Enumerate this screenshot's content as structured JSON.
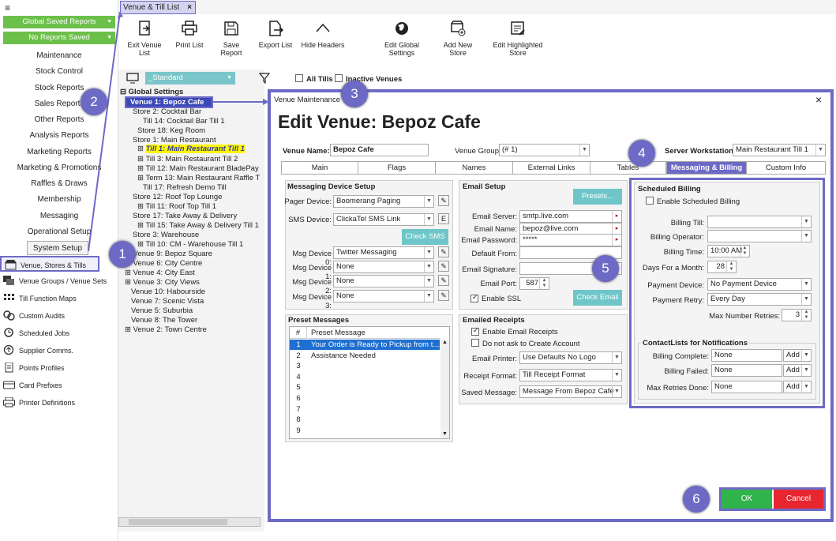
{
  "sidebar": {
    "menu_icon": "hamburger-icon",
    "global_saved_reports": "Global Saved Reports",
    "no_reports_saved": "No Reports Saved",
    "menu_items": [
      "Maintenance",
      "Stock Control",
      "Stock Reports",
      "Sales Reports",
      "Other Reports",
      "Analysis Reports",
      "Marketing Reports",
      "Marketing & Promotions",
      "Raffles & Draws",
      "Membership",
      "Messaging",
      "Operational Setup",
      "System Setup"
    ],
    "nav_items": [
      "Venue, Stores & Tills",
      "Venue Groups / Venue Sets",
      "Till Function Maps",
      "Custom Audits",
      "Scheduled Jobs",
      "Supplier Comms.",
      "Points Profiles",
      "Card Prefixes",
      "Printer Definitions"
    ]
  },
  "tab": {
    "label": "Venue & Till List",
    "close": "×"
  },
  "toolbar": {
    "buttons": [
      "Exit Venue List",
      "Print List",
      "Save Report",
      "Export List",
      "Hide Headers",
      "Edit Global Settings",
      "Add New Store",
      "Edit Highlighted Store"
    ]
  },
  "filters": {
    "dropdown": "_Standard",
    "all_tills": "All Tills",
    "inactive_venues": "Inactive Venues"
  },
  "tree": {
    "header": "Global Settings",
    "selected": "Venue 1: Bepoz Cafe",
    "nodes": [
      "Store 2: Cocktail Bar",
      "Till 14: Cocktail Bar Till 1",
      "Store 18: Keg Room",
      "Store 1: Main Restaurant",
      "Till 1: Main Restaurant Till 1",
      "Till 3: Main Restaurant Till 2",
      "Till 12: Main Restaurant BladePay",
      "Term 13: Main Restaurant Raffle T",
      "Till 17: Refresh Demo Till",
      "Store 12: Roof Top Lounge",
      "Till 11: Roof Top Till 1",
      "Store 17: Take Away & Delivery",
      "Till 15: Take Away & Delivery Till 1",
      "Store 3: Warehouse",
      "Till 10: CM - Warehouse Till 1",
      "Venue 9: Bepoz Square",
      "Venue 6: City Centre",
      "Venue 4: City East",
      "Venue 3: City Views",
      "Venue 10: Habourside",
      "Venue 7: Scenic Vista",
      "Venue 5: Suburbia",
      "Venue 8: The Tower",
      "Venue 2: Town Centre"
    ]
  },
  "dialog": {
    "window_title": "Venue Maintenance",
    "close": "×",
    "heading": "Edit Venue: Bepoz Cafe",
    "venue_name_label": "Venue Name:",
    "venue_name": "Bepoz Cafe",
    "venue_group_label": "Venue Group:",
    "venue_group": "(# 1)",
    "server_ws_label": "Server Workstation:",
    "server_ws": "Main Restaurant Till 1",
    "tabs": [
      "Main",
      "Flags",
      "Names",
      "External Links",
      "Tables",
      "Messaging & Billing",
      "Custom Info"
    ],
    "messaging": {
      "title": "Messaging Device Setup",
      "pager_label": "Pager Device:",
      "pager": "Boomerang Paging",
      "sms_label": "SMS Device:",
      "sms": "ClickaTel SMS Link",
      "sms_e": "E",
      "check_sms": "Check SMS",
      "msg_labels": [
        "Msg Device 0:",
        "Msg Device 1:",
        "Msg Device 2:",
        "Msg Device 3:"
      ],
      "msg_values": [
        "Twitter Messaging",
        "None",
        "None",
        "None"
      ]
    },
    "email": {
      "title": "Email Setup",
      "presets": "Presets...",
      "server_label": "Email Server:",
      "server": "smtp.live.com",
      "name_label": "Email Name:",
      "name": "bepoz@live.com",
      "password_label": "Email Password:",
      "password": "*****",
      "default_from_label": "Default From:",
      "signature_label": "Email Signature:",
      "port_label": "Email Port:",
      "port": "587",
      "ssl": "Enable SSL",
      "check_email": "Check Email"
    },
    "preset_messages": {
      "title": "Preset Messages",
      "col_num": "#",
      "col_msg": "Preset Message",
      "rows": [
        {
          "n": "1",
          "m": "Your Order is Ready to Pickup from t..."
        },
        {
          "n": "2",
          "m": "Assistance Needed"
        },
        {
          "n": "3",
          "m": ""
        },
        {
          "n": "4",
          "m": ""
        },
        {
          "n": "5",
          "m": ""
        },
        {
          "n": "6",
          "m": ""
        },
        {
          "n": "7",
          "m": ""
        },
        {
          "n": "8",
          "m": ""
        },
        {
          "n": "9",
          "m": ""
        }
      ]
    },
    "receipts": {
      "title": "Emailed Receipts",
      "enable": "Enable Email Receipts",
      "no_ask": "Do not ask to Create Account",
      "printer_label": "Email Printer:",
      "printer": "Use Defaults No Logo",
      "format_label": "Receipt Format:",
      "format": "Till Receipt Format",
      "saved_label": "Saved Message:",
      "saved": "Message From Bepoz Cafe"
    },
    "billing": {
      "title": "Scheduled Billing",
      "enable": "Enable Scheduled Billing",
      "till_label": "Billing Till:",
      "operator_label": "Billing Operator:",
      "time_label": "Billing Time:",
      "time": "10:00 AM",
      "days_label": "Days For a Month:",
      "days": "28",
      "payment_device_label": "Payment Device:",
      "payment_device": "No Payment Device",
      "payment_retry_label": "Payment Retry:",
      "payment_retry": "Every Day",
      "max_retries_label": "Max Number Retries:",
      "max_retries": "3"
    },
    "contacts": {
      "title": "ContactLists for Notifications",
      "rows": [
        {
          "label": "Billing Complete:",
          "value": "None",
          "add": "Add"
        },
        {
          "label": "Billing Failed:",
          "value": "None",
          "add": "Add"
        },
        {
          "label": "Max Retries Done:",
          "value": "None",
          "add": "Add"
        }
      ]
    },
    "ok": "OK",
    "cancel": "Cancel"
  },
  "callouts": [
    "1",
    "2",
    "3",
    "4",
    "5",
    "6"
  ]
}
